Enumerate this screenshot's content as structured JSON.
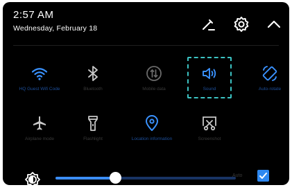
{
  "status": {
    "time": "2:57 AM",
    "date": "Wednesday, February 18"
  },
  "header_icons": [
    "edit-icon",
    "settings-gear-icon",
    "collapse-chevron-up-icon"
  ],
  "tiles": [
    {
      "label": "HQ Guest Wifi Code",
      "icon": "wifi-icon",
      "active": true
    },
    {
      "label": "Bluetooth",
      "icon": "bluetooth-icon",
      "active": false
    },
    {
      "label": "Mobile data",
      "icon": "mobile-data-icon",
      "active": false
    },
    {
      "label": "Sound",
      "icon": "sound-icon",
      "active": true
    },
    {
      "label": "Auto-rotate",
      "icon": "auto-rotate-icon",
      "active": true
    },
    {
      "label": "Airplane mode",
      "icon": "airplane-icon",
      "active": false
    },
    {
      "label": "Flashlight",
      "icon": "flashlight-icon",
      "active": false
    },
    {
      "label": "Location information",
      "icon": "location-pin-icon",
      "active": true
    },
    {
      "label": "Screenshot",
      "icon": "screenshot-icon",
      "active": false
    }
  ],
  "brightness": {
    "level": 0.33,
    "auto_label": "Auto",
    "auto_checked": true
  },
  "colors": {
    "accent": "#2e88f0",
    "active_icon": "#3a92ff",
    "inactive_icon": "#c8c8c8",
    "highlight_border": "#3cc3c3"
  }
}
